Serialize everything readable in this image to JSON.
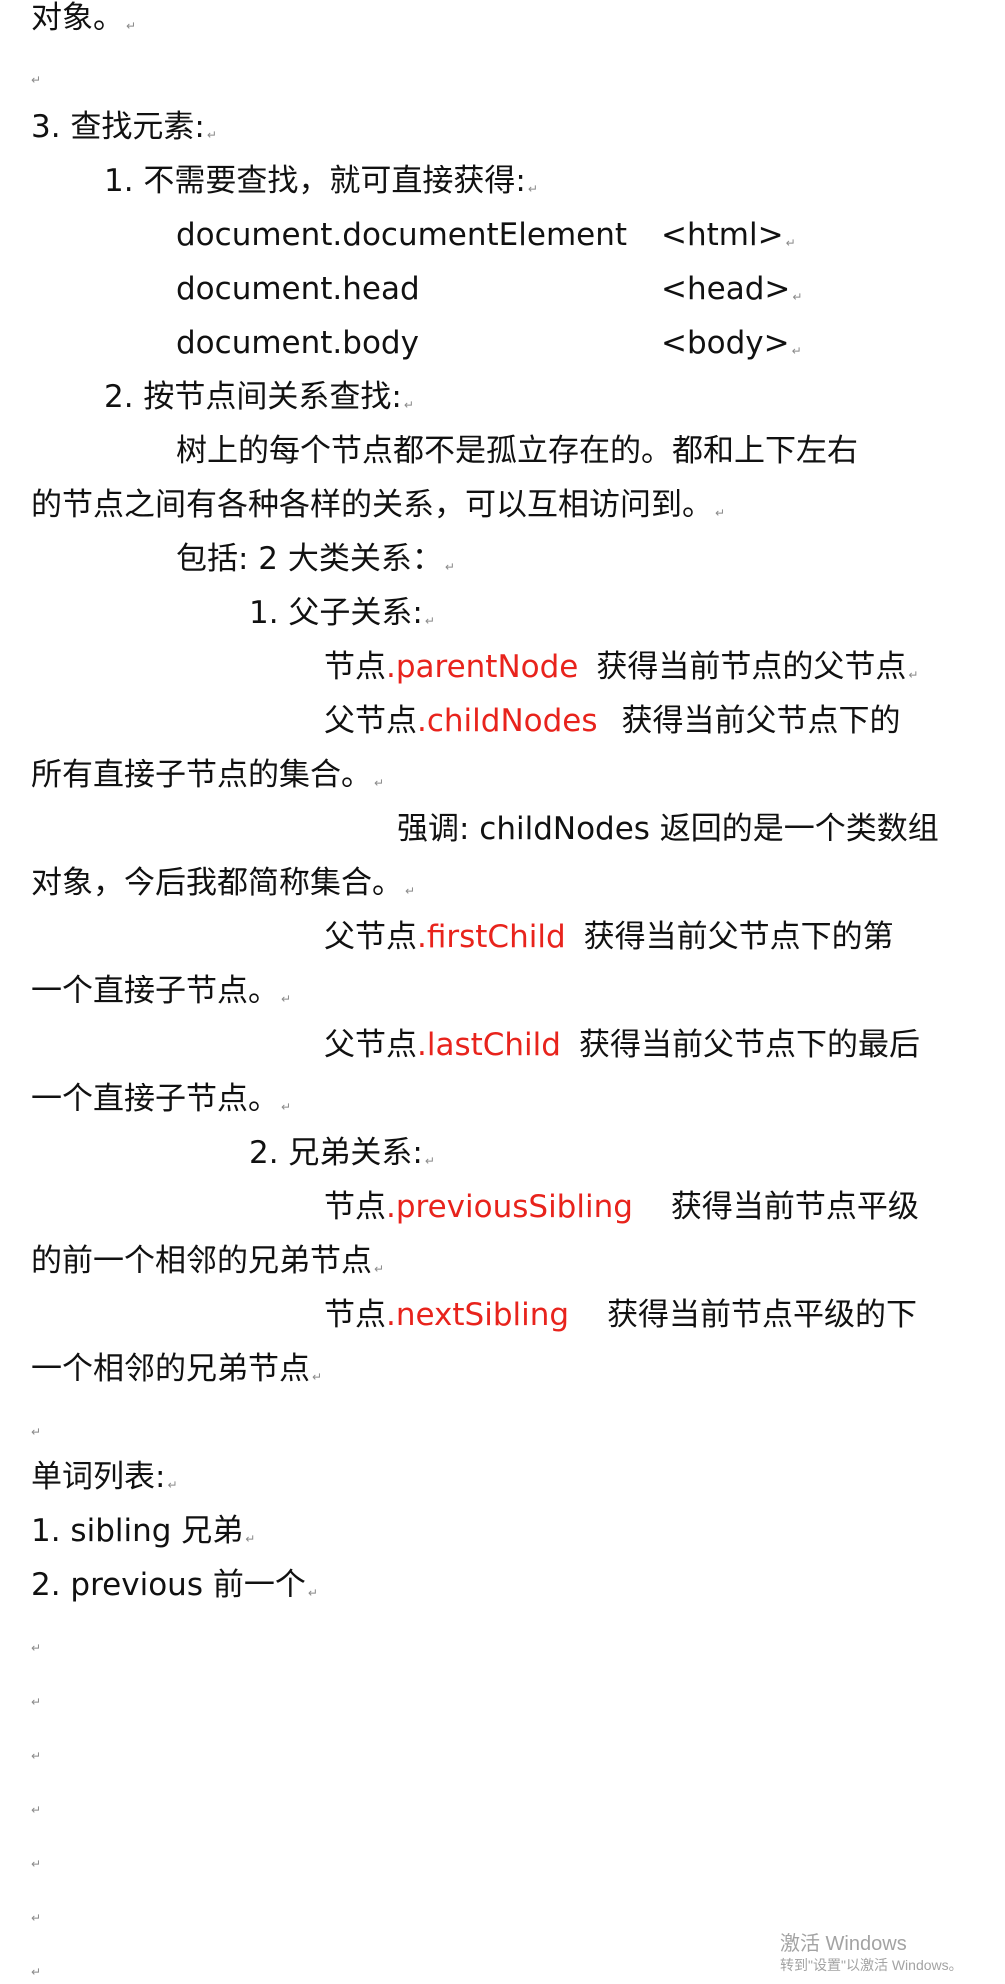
{
  "lines": {
    "l00": "对象。",
    "l03": "3.  查找元素:",
    "l04": "1.  不需要查找，就可直接获得:",
    "l05a": "document.documentElement",
    "l05b": "<html>",
    "l06a": "document.head",
    "l06b": "<head>",
    "l07a": "document.body",
    "l07b": "<body>",
    "l08": "2.  按节点间关系查找:",
    "l09": "树上的每个节点都不是孤立存在的。都和上下左右",
    "l10": "的节点之间有各种各样的关系，可以互相访问到。",
    "l11": "包括: 2 大类关系：",
    "l12": "1.  父子关系:",
    "l13a": "节点",
    "l13b": ".parentNode",
    "l13c": "获得当前节点的父节点",
    "l14a": "父节点",
    "l14b": ".childNodes",
    "l14c": "获得当前父节点下的",
    "l15": "所有直接子节点的集合。",
    "l16": "强调: childNodes 返回的是一个类数组",
    "l17": "对象，今后我都简称集合。",
    "l18a": "父节点",
    "l18b": ".firstChild",
    "l18c": "获得当前父节点下的第",
    "l19": "一个直接子节点。",
    "l20a": "父节点",
    "l20b": ".lastChild",
    "l20c": "获得当前父节点下的最后",
    "l21": "一个直接子节点。",
    "l22": "2.  兄弟关系:",
    "l23a": "节点",
    "l23b": ".previousSibling",
    "l23c": "获得当前节点平级",
    "l24": "的前一个相邻的兄弟节点",
    "l25a": "节点",
    "l25b": ".nextSibling",
    "l25c": "获得当前节点平级的下",
    "l26": "一个相邻的兄弟节点",
    "l28": "单词列表:",
    "l29": "1. sibling  兄弟",
    "l30": "2. previous  前一个"
  },
  "marks": {
    "paragraph": "↵"
  },
  "watermark": {
    "line1": "激活 Windows",
    "line2": "转到\"设置\"以激活 Windows。"
  }
}
